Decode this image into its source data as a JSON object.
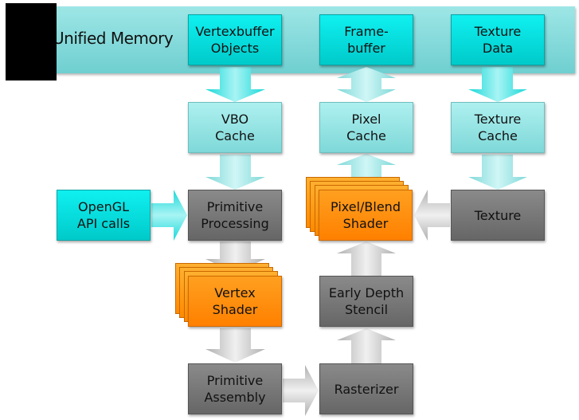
{
  "memory_band": {
    "label": "Unified Memory"
  },
  "colors": {
    "memory": "#00d8d8",
    "cache": "#90e0e0",
    "fixed_function": "#777777",
    "programmable_shader": "#ff8800"
  },
  "boxes": {
    "vbo_objects": "Vertexbuffer\nObjects",
    "framebuffer": "Frame-\nbuffer",
    "texture_data": "Texture\nData",
    "vbo_cache": "VBO\nCache",
    "pixel_cache": "Pixel\nCache",
    "texture_cache": "Texture\nCache",
    "opengl_api": "OpenGL\nAPI calls",
    "primitive_processing": "Primitive\nProcessing",
    "pixel_blend_shader": "Pixel/Blend\nShader",
    "texture": "Texture",
    "vertex_shader": "Vertex\nShader",
    "early_depth_stencil": "Early Depth\nStencil",
    "primitive_assembly": "Primitive\nAssembly",
    "rasterizer": "Rasterizer"
  }
}
